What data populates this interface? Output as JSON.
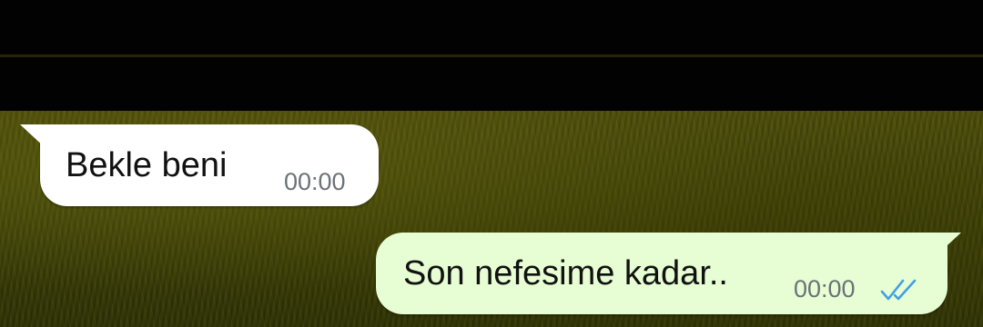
{
  "chat": {
    "messages": [
      {
        "direction": "incoming",
        "text": "Bekle beni",
        "time": "00:00"
      },
      {
        "direction": "outgoing",
        "text": "Son nefesime kadar..",
        "time": "00:00",
        "status_icon": "double-check-read-icon"
      }
    ]
  },
  "colors": {
    "incoming_bubble": "#ffffff",
    "outgoing_bubble": "#e7fdd3",
    "read_check": "#3fa0e6",
    "time_text": "#6b7278",
    "top_bar": "#020202",
    "wallpaper": "#46480a"
  }
}
